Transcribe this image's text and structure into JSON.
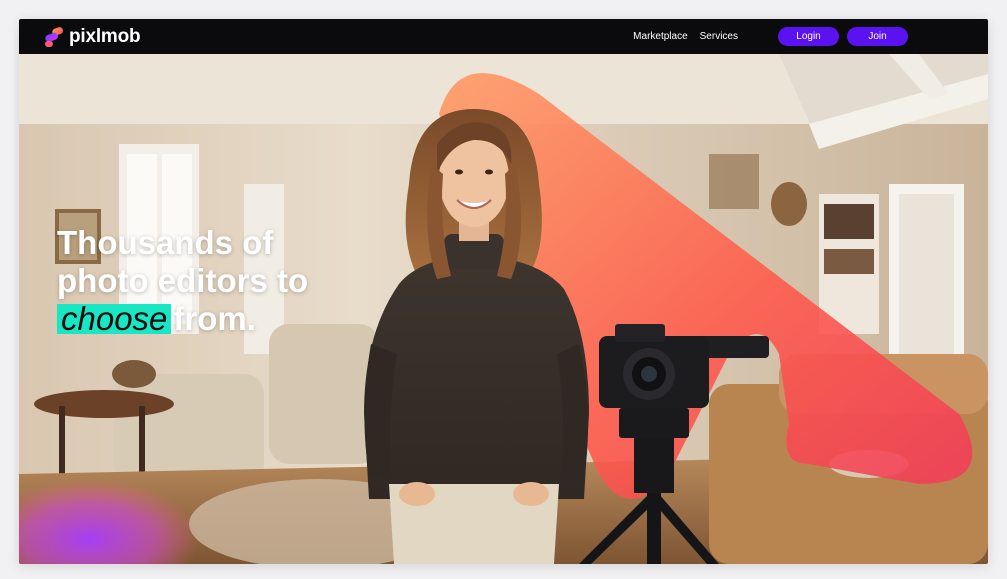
{
  "brand": {
    "name": "pixlmob",
    "icon": "pixlmob-logo-icon"
  },
  "nav": {
    "links": [
      "Marketplace",
      "Services"
    ],
    "login_label": "Login",
    "join_label": "Join"
  },
  "hero": {
    "headline_line1": "Thousands of",
    "headline_line2": "photo editors to",
    "headline_highlight": "choose",
    "headline_end": "from.",
    "image": "woman-with-camera-photo"
  },
  "colors": {
    "nav_bg": "#0b0b0d",
    "button": "#5b12f0",
    "highlight": "#19e6c2",
    "swoosh_start": "#ff8a5a",
    "swoosh_end": "#f24455"
  }
}
